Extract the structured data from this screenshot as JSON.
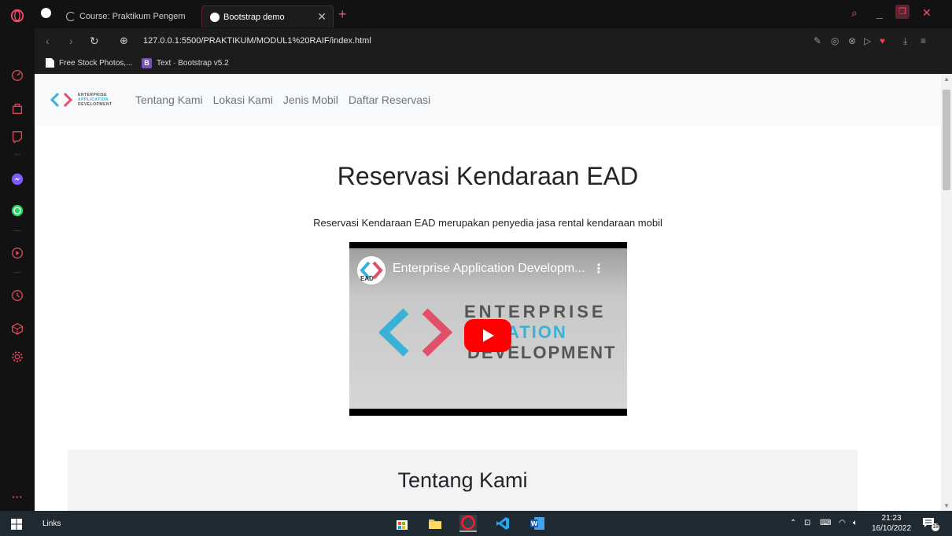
{
  "browser": {
    "tabs": [
      {
        "title": "Course: Praktikum Pengem",
        "active": false
      },
      {
        "title": "Bootstrap demo",
        "active": true
      }
    ],
    "new_tab_label": "+",
    "url": "127.0.0.1:5500/PRAKTIKUM/MODUL1%20RAIF/index.html",
    "bookmarks": [
      {
        "label": "Free Stock Photos,..."
      },
      {
        "label": "Text · Bootstrap v5.2"
      }
    ]
  },
  "page": {
    "brand": {
      "line1": "ENTERPRISE",
      "line2": "APPLICATION",
      "line3": "DEVELOPMENT"
    },
    "nav_links": [
      "Tentang Kami",
      "Lokasi Kami",
      "Jenis Mobil",
      "Daftar Reservasi"
    ],
    "hero_title": "Reservasi Kendaraan EAD",
    "hero_subtitle": "Reservasi Kendaraan EAD merupakan penyedia jasa rental kendaraan mobil",
    "video": {
      "title": "Enterprise Application Developm...",
      "channel_badge": "EAD",
      "logo_text": [
        "ENTERPRISE",
        "ICATION",
        "DEVELOPMENT"
      ]
    },
    "about_title": "Tentang Kami"
  },
  "taskbar": {
    "links_label": "Links",
    "time": "21:23",
    "date": "16/10/2022",
    "notification_count": "18"
  },
  "colors": {
    "opera_red": "#ff4d6a",
    "brand_blue": "#3ab1d6",
    "youtube_red": "#ff0000"
  }
}
